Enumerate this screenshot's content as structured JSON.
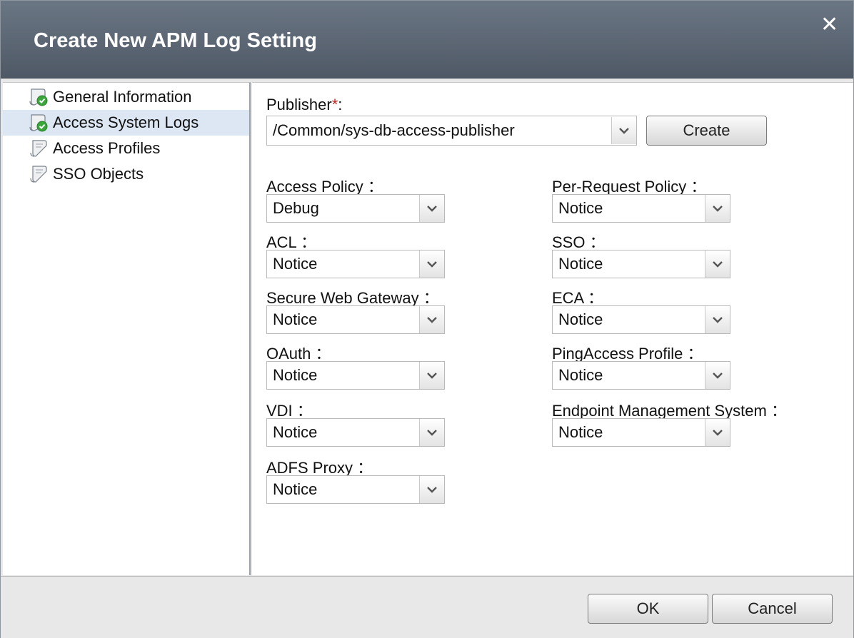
{
  "dialog": {
    "title": "Create New APM Log Setting"
  },
  "sidebar": {
    "items": [
      {
        "label": "General Information",
        "icon": "scroll-check-icon",
        "selected": false
      },
      {
        "label": "Access System Logs",
        "icon": "scroll-check-icon",
        "selected": true
      },
      {
        "label": "Access Profiles",
        "icon": "scroll-icon",
        "selected": false
      },
      {
        "label": "SSO Objects",
        "icon": "scroll-icon",
        "selected": false
      }
    ]
  },
  "publisher": {
    "label": "Publisher",
    "required_mark": "*",
    "suffix": ":",
    "value": "/Common/sys-db-access-publisher",
    "create_label": "Create"
  },
  "fields": {
    "access_policy": {
      "label": "Access Policy ：",
      "value": "Debug"
    },
    "acl": {
      "label": "ACL ：",
      "value": "Notice"
    },
    "secure_web_gateway": {
      "label": "Secure Web Gateway ：",
      "value": "Notice"
    },
    "oauth": {
      "label": "OAuth ：",
      "value": "Notice"
    },
    "vdi": {
      "label": "VDI ：",
      "value": "Notice"
    },
    "adfs_proxy": {
      "label": "ADFS Proxy ：",
      "value": "Notice"
    },
    "per_request_policy": {
      "label": "Per-Request Policy ：",
      "value": "Notice"
    },
    "sso": {
      "label": "SSO ：",
      "value": "Notice"
    },
    "eca": {
      "label": "ECA ：",
      "value": "Notice"
    },
    "pingaccess_profile": {
      "label": "PingAccess Profile ：",
      "value": "Notice"
    },
    "endpoint_management_system": {
      "label": "Endpoint Management System ：",
      "value": "Notice"
    }
  },
  "footer": {
    "ok_label": "OK",
    "cancel_label": "Cancel"
  },
  "colors": {
    "header": "#58626f",
    "selected_row": "#dde6f3",
    "required": "#c02020",
    "check_green": "#3aa53a"
  }
}
